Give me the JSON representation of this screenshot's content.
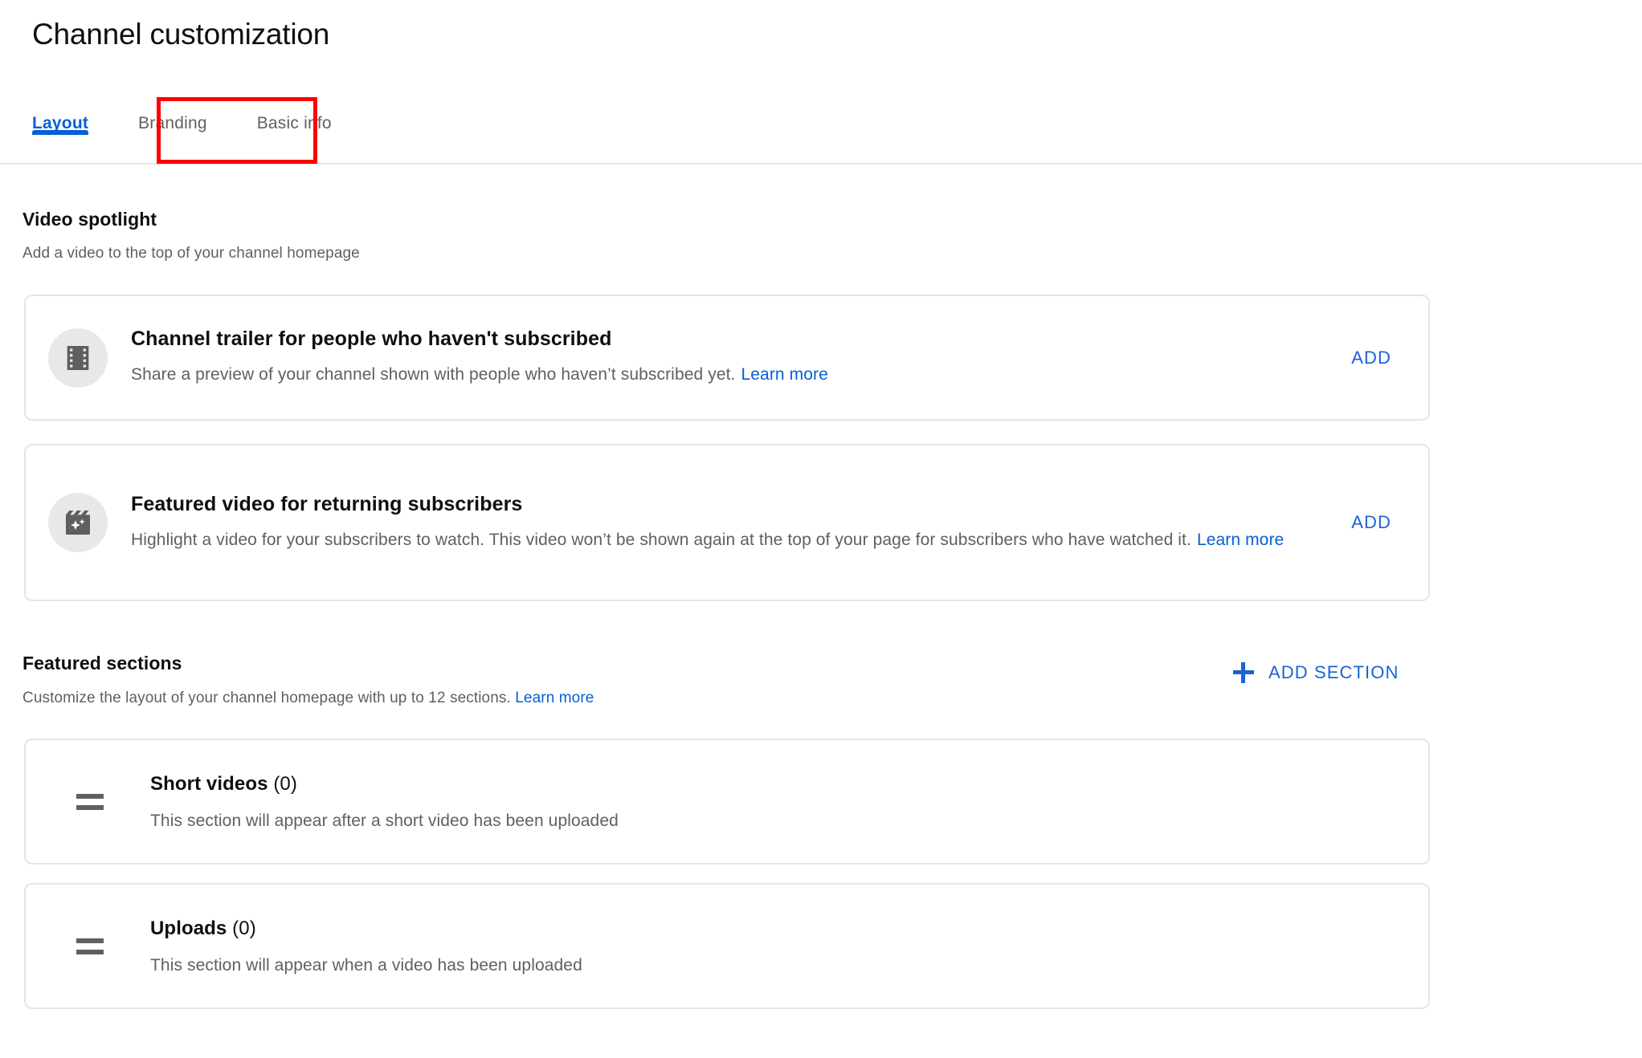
{
  "header": {
    "title": "Channel customization"
  },
  "tabs": [
    {
      "label": "Layout",
      "active": true,
      "name": "tab-layout"
    },
    {
      "label": "Branding",
      "active": false,
      "name": "tab-branding",
      "highlighted": true
    },
    {
      "label": "Basic info",
      "active": false,
      "name": "tab-basic-info"
    }
  ],
  "highlight": {
    "color": "#ff0000",
    "target": "Branding"
  },
  "video_spotlight": {
    "title": "Video spotlight",
    "subtitle": "Add a video to the top of your channel homepage",
    "cards": [
      {
        "icon": "film-strip-icon",
        "title": "Channel trailer for people who haven't subscribed",
        "description": "Share a preview of your channel shown with people who haven’t subscribed yet.",
        "learn_more": "Learn more",
        "action_label": "ADD"
      },
      {
        "icon": "clapperboard-sparkle-icon",
        "title": "Featured video for returning subscribers",
        "description": "Highlight a video for your subscribers to watch. This video won’t be shown again at the top of your page for subscribers who have watched it.",
        "learn_more": "Learn more",
        "action_label": "ADD"
      }
    ]
  },
  "featured_sections": {
    "title": "Featured sections",
    "subtitle": "Customize the layout of your channel homepage with up to 12 sections.",
    "learn_more": "Learn more",
    "add_section_label": "ADD SECTION",
    "max_sections": 12,
    "rows": [
      {
        "name": "Short videos",
        "count": "(0)",
        "description": "This section will appear after a short video has been uploaded",
        "handle": "drag-handle-icon"
      },
      {
        "name": "Uploads",
        "count": "(0)",
        "description": "This section will appear when a video has been uploaded",
        "handle": "drag-handle-icon"
      }
    ]
  },
  "colors": {
    "accent_blue": "#065fd4",
    "link_blue": "#1a62d6",
    "highlight_red": "#ff0000",
    "text_primary": "#0f0f0f",
    "text_secondary": "#606060",
    "border": "#e5e5e5"
  }
}
